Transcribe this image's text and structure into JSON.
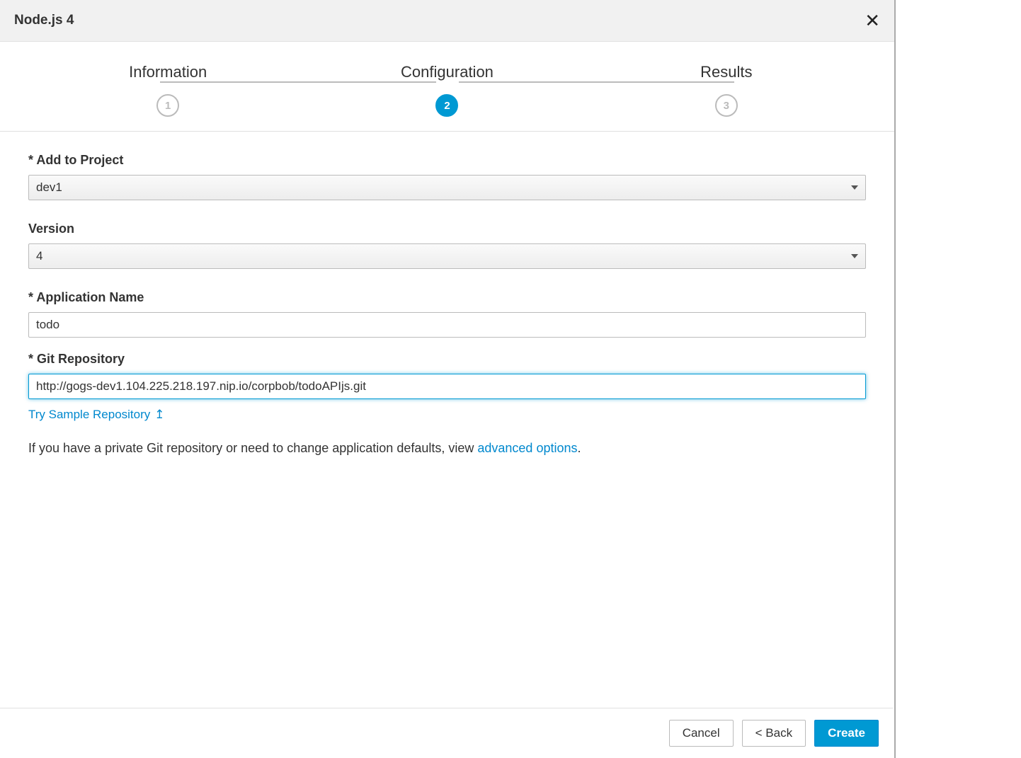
{
  "header": {
    "title": "Node.js 4"
  },
  "wizard": {
    "steps": [
      {
        "label": "Information",
        "num": "1",
        "active": false
      },
      {
        "label": "Configuration",
        "num": "2",
        "active": true
      },
      {
        "label": "Results",
        "num": "3",
        "active": false
      }
    ]
  },
  "form": {
    "project": {
      "label": "* Add to Project",
      "value": "dev1"
    },
    "version": {
      "label": "Version",
      "value": "4"
    },
    "appname": {
      "label": "* Application Name",
      "value": "todo"
    },
    "gitrepo": {
      "label": "* Git Repository",
      "value": "http://gogs-dev1.104.225.218.197.nip.io/corpbob/todoAPIjs.git"
    },
    "try_sample": "Try Sample Repository",
    "help_prefix": "If you have a private Git repository or need to change application defaults, view ",
    "help_link": "advanced options",
    "help_suffix": "."
  },
  "footer": {
    "cancel": "Cancel",
    "back": "< Back",
    "create": "Create"
  }
}
